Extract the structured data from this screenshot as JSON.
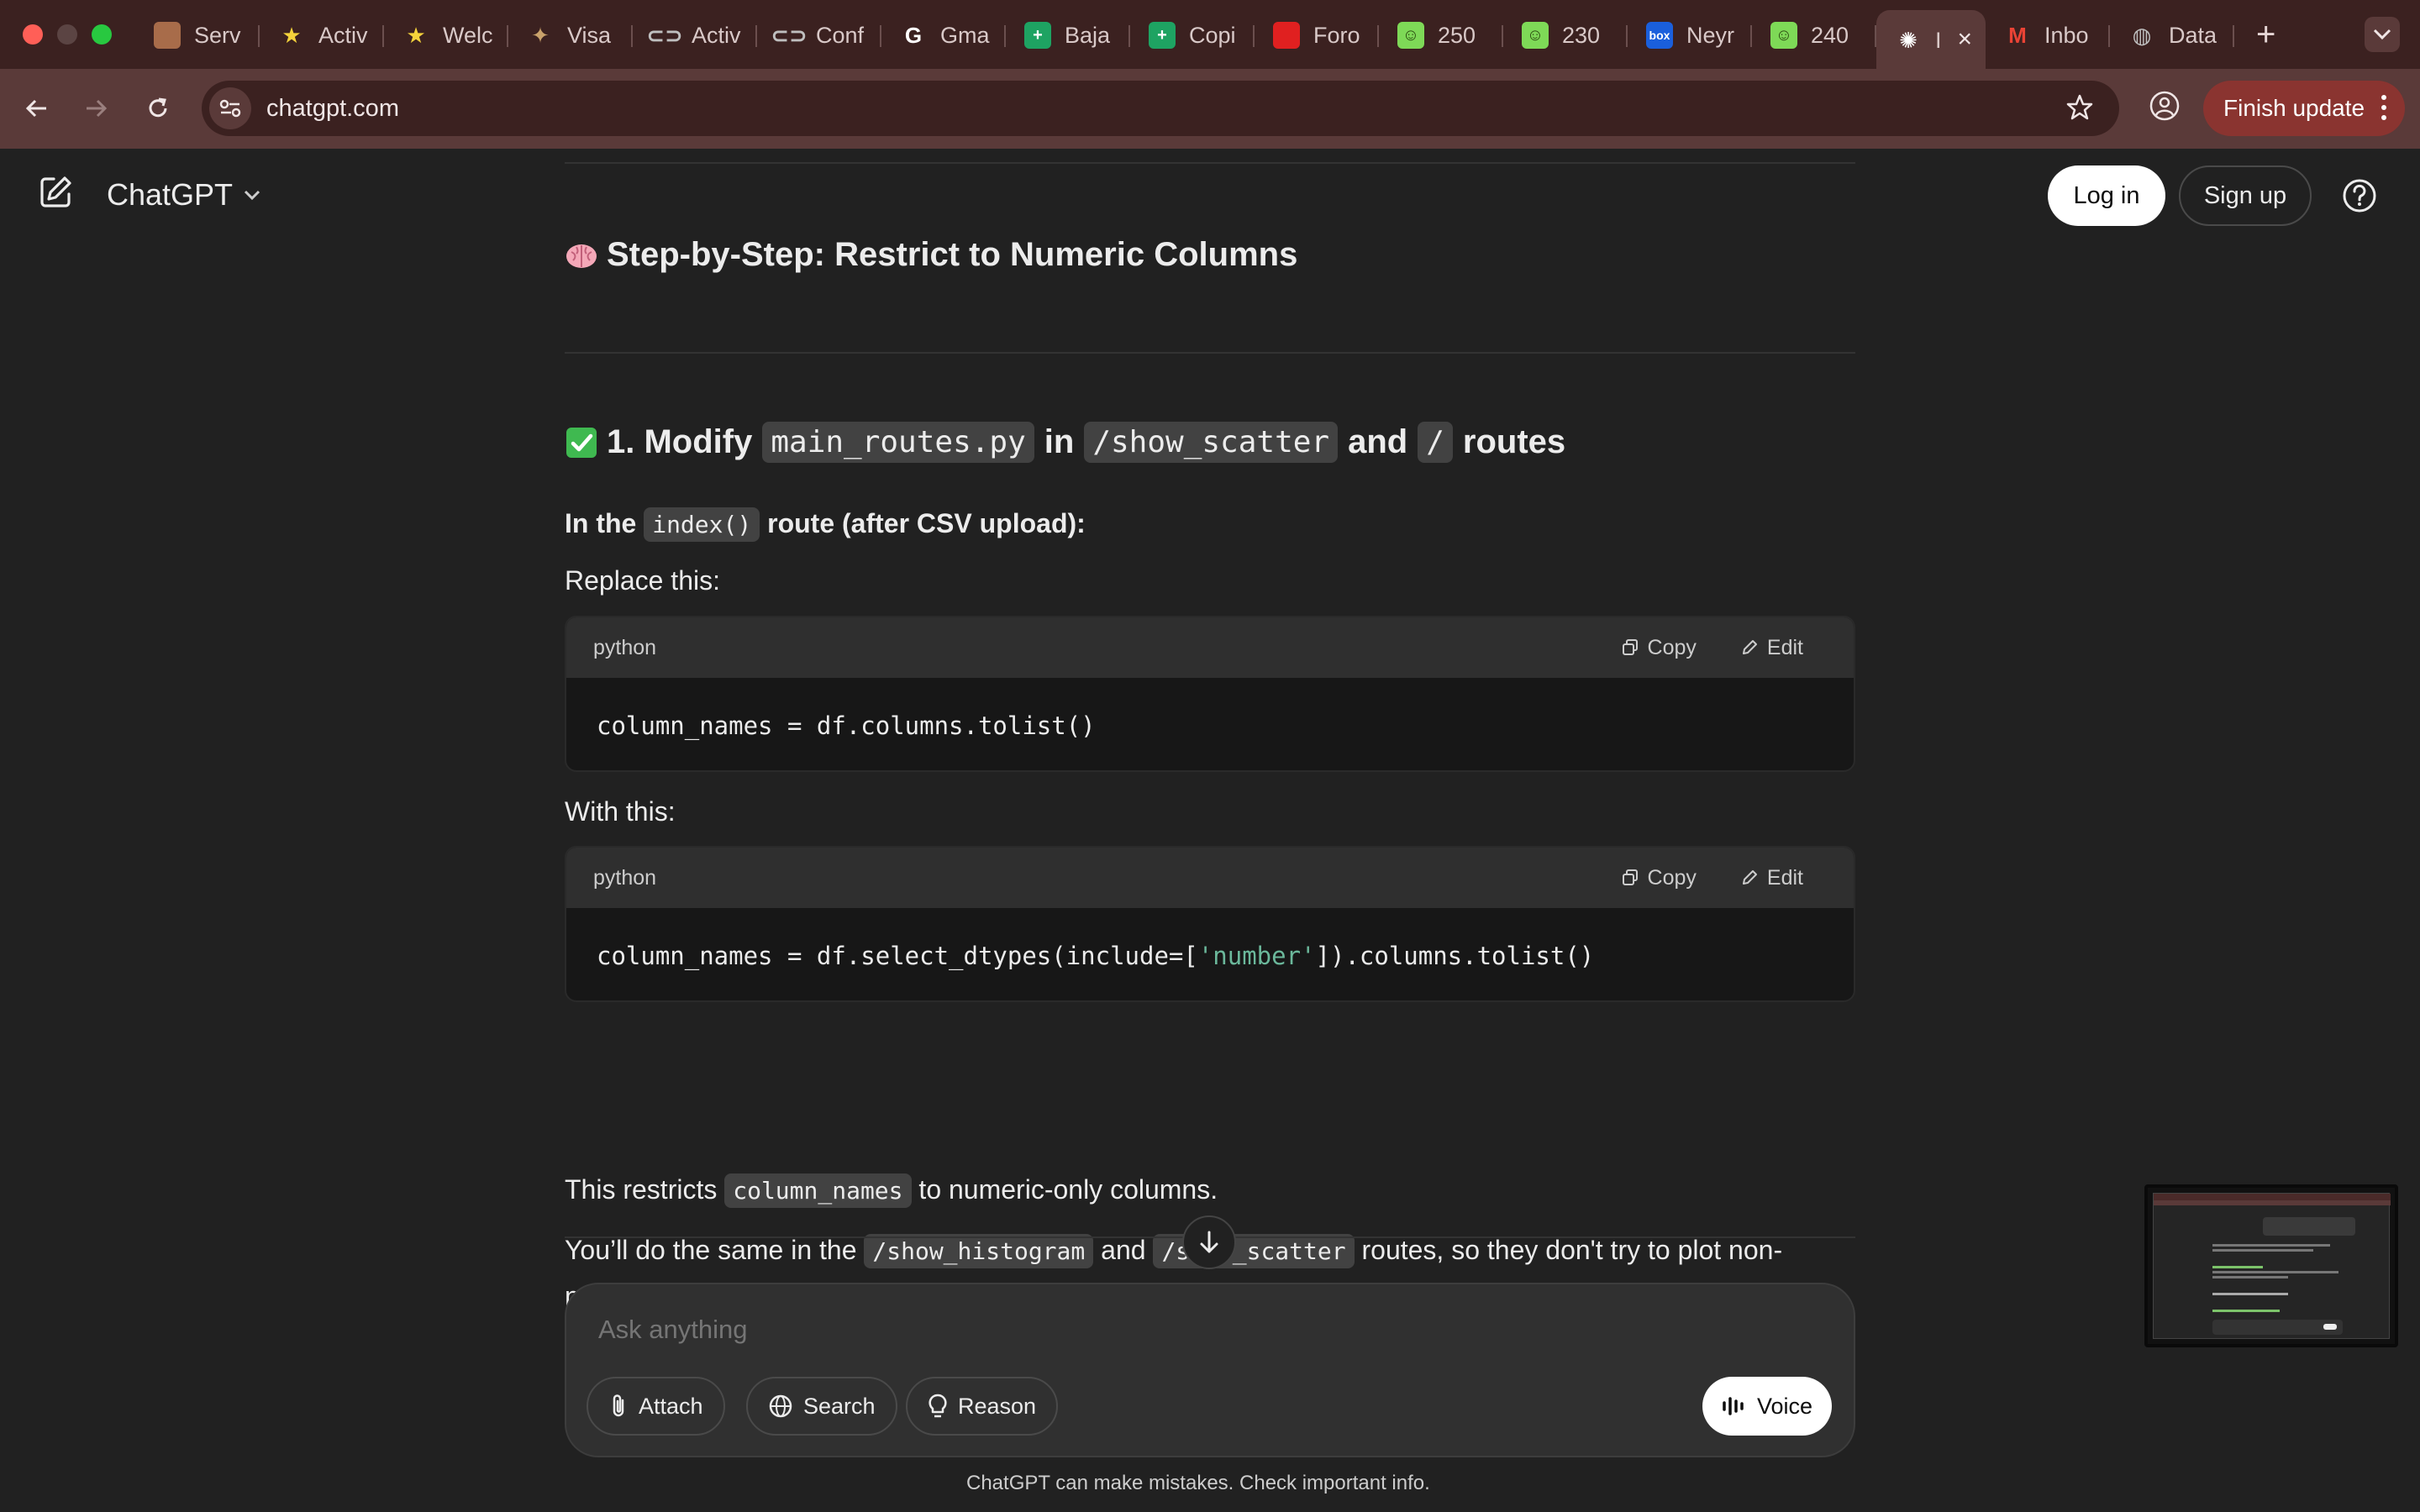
{
  "browser": {
    "tabs": [
      {
        "label": "Serv",
        "icon": "portrait-favicon",
        "color": "#a86c4a"
      },
      {
        "label": "Activ",
        "icon": "star-favicon",
        "color": "#f5d33b"
      },
      {
        "label": "Welc",
        "icon": "star-favicon",
        "color": "#f5d33b"
      },
      {
        "label": "Visa",
        "icon": "seal-favicon",
        "color": "#c9a26b"
      },
      {
        "label": "Activ",
        "icon": "link-favicon",
        "color": "#bfbfbf"
      },
      {
        "label": "Conf",
        "icon": "link-favicon",
        "color": "#bfbfbf"
      },
      {
        "label": "Gma",
        "icon": "google-favicon",
        "color": "#ffffff"
      },
      {
        "label": "Baja",
        "icon": "sheets-plus-favicon",
        "color": "#1ea362"
      },
      {
        "label": "Copi",
        "icon": "sheets-plus-favicon",
        "color": "#1ea362"
      },
      {
        "label": "Foro",
        "icon": "red-logo-favicon",
        "color": "#e02020"
      },
      {
        "label": "250",
        "icon": "smiley-favicon",
        "color": "#7ed957"
      },
      {
        "label": "230",
        "icon": "smiley-favicon",
        "color": "#7ed957"
      },
      {
        "label": "Neyr",
        "icon": "box-favicon",
        "color": "#1a5fdc"
      },
      {
        "label": "240",
        "icon": "smiley-favicon",
        "color": "#7ed957"
      },
      {
        "label": "I",
        "icon": "openai-favicon",
        "color": "#ffffff",
        "active": true
      },
      {
        "label": "Inbo",
        "icon": "gmail-favicon",
        "color": "#ea4335"
      },
      {
        "label": "Data",
        "icon": "globe-favicon",
        "color": "#bfbfbf"
      }
    ],
    "url": "chatgpt.com",
    "finish_update": "Finish update"
  },
  "header": {
    "model": "ChatGPT",
    "login": "Log in",
    "signup": "Sign up"
  },
  "content": {
    "heading1": {
      "emoji": "🧠",
      "text": "Step-by-Step: Restrict to Numeric Columns"
    },
    "heading2": {
      "emoji": "✅",
      "pre": "1. Modify",
      "code1": "main_routes.py",
      "mid1": "in",
      "code2": "/show_scatter",
      "mid2": "and",
      "code3": "/",
      "post": "routes"
    },
    "subheading": {
      "pre": "In the",
      "code": "index()",
      "post": "route (after CSV upload):"
    },
    "replace_label": "Replace this:",
    "code_block1": {
      "lang": "python",
      "copy": "Copy",
      "edit": "Edit",
      "code": "column_names = df.columns.tolist()"
    },
    "with_label": "With this:",
    "code_block2": {
      "lang": "python",
      "copy": "Copy",
      "edit": "Edit",
      "code_pre": "column_names = df.select_dtypes(include=[",
      "code_str": "'number'",
      "code_post": "]).columns.tolist()"
    },
    "restrict_para": {
      "pre": "This restricts",
      "code": "column_names",
      "post": "to numeric-only columns."
    },
    "same_para": {
      "pre": "You’ll do the same in the",
      "code1": "/show_histogram",
      "mid": "and",
      "code2": "/show_scatter",
      "post": "routes, so they don't try to plot non-",
      "line2": "numeric columns."
    }
  },
  "composer": {
    "placeholder": "Ask anything",
    "attach": "Attach",
    "search": "Search",
    "reason": "Reason",
    "voice": "Voice"
  },
  "disclaimer": "ChatGPT can make mistakes. Check important info."
}
